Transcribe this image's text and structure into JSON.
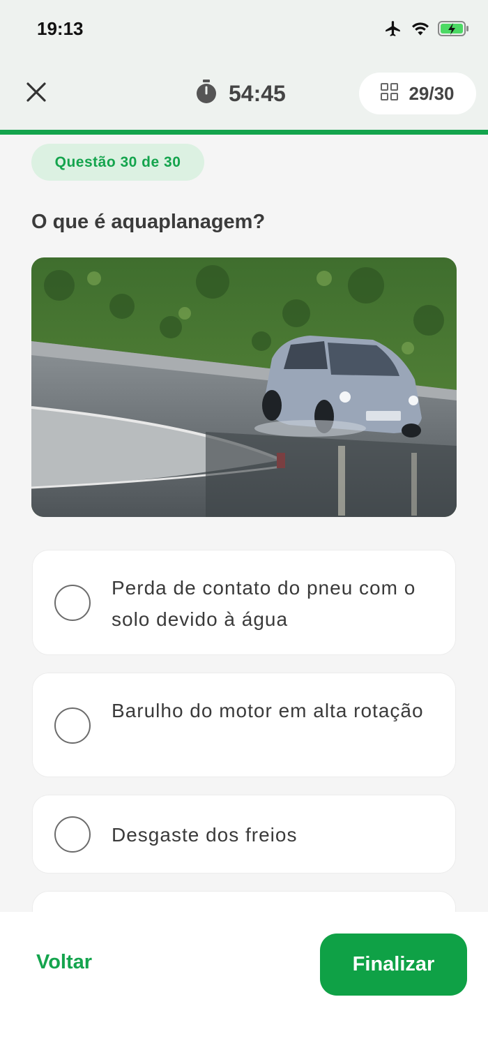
{
  "status_bar": {
    "time": "19:13",
    "icons": [
      "airplane-icon",
      "wifi-icon",
      "battery-charging-icon"
    ]
  },
  "header": {
    "close_icon": "close-icon",
    "timer_icon": "stopwatch-icon",
    "timer": "54:45",
    "grid_icon": "grid-icon",
    "progress": "29/30"
  },
  "colors": {
    "accent": "#14a44d",
    "badge_bg": "#dcf1e2",
    "header_bg": "#eef2ef",
    "page_bg": "#f5f5f5"
  },
  "question": {
    "badge": "Questão 30 de 30",
    "text": "O que é aquaplanagem?",
    "image": "car-aquaplaning-photo"
  },
  "options": [
    {
      "text": "Perda de contato do pneu com o solo devido à água"
    },
    {
      "text": "Barulho do motor em alta rotação"
    },
    {
      "text": "Desgaste dos freios"
    },
    {
      "text": ""
    }
  ],
  "footer": {
    "back_label": "Voltar",
    "finish_label": "Finalizar"
  }
}
